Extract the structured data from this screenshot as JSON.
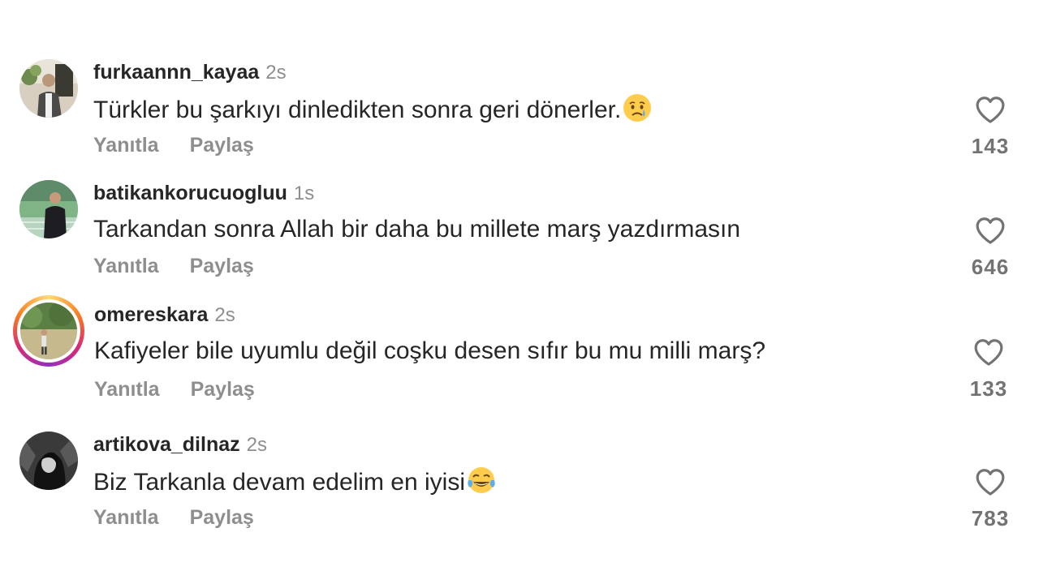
{
  "actions": {
    "reply_label": "Yanıtla",
    "share_label": "Paylaş"
  },
  "comments": [
    {
      "username": "furkaannn_kayaa",
      "time": "2s",
      "text": "Türkler bu şarkıyı dinledikten sonra geri dönerler.",
      "emoji": "crying-face-emoji",
      "likes": "143",
      "has_story_ring": false
    },
    {
      "username": "batikankorucuogluu",
      "time": "1s",
      "text": "Tarkandan sonra Allah bir daha bu millete marş yazdırmasın",
      "emoji": "",
      "likes": "646",
      "has_story_ring": false
    },
    {
      "username": "omereskara",
      "time": "2s",
      "text": "Kafiyeler bile uyumlu değil coşku desen sıfır bu mu milli marş?",
      "emoji": "",
      "likes": "133",
      "has_story_ring": true
    },
    {
      "username": "artikova_dilnaz",
      "time": "2s",
      "text": "Biz Tarkanla devam edelim en iyisi",
      "emoji": "tears-of-joy-emoji",
      "likes": "783",
      "has_story_ring": false
    }
  ],
  "colors": {
    "username": "#262626",
    "secondary_text": "#8e8e8e",
    "like_count": "#737373",
    "heart_outline": "#737373"
  }
}
